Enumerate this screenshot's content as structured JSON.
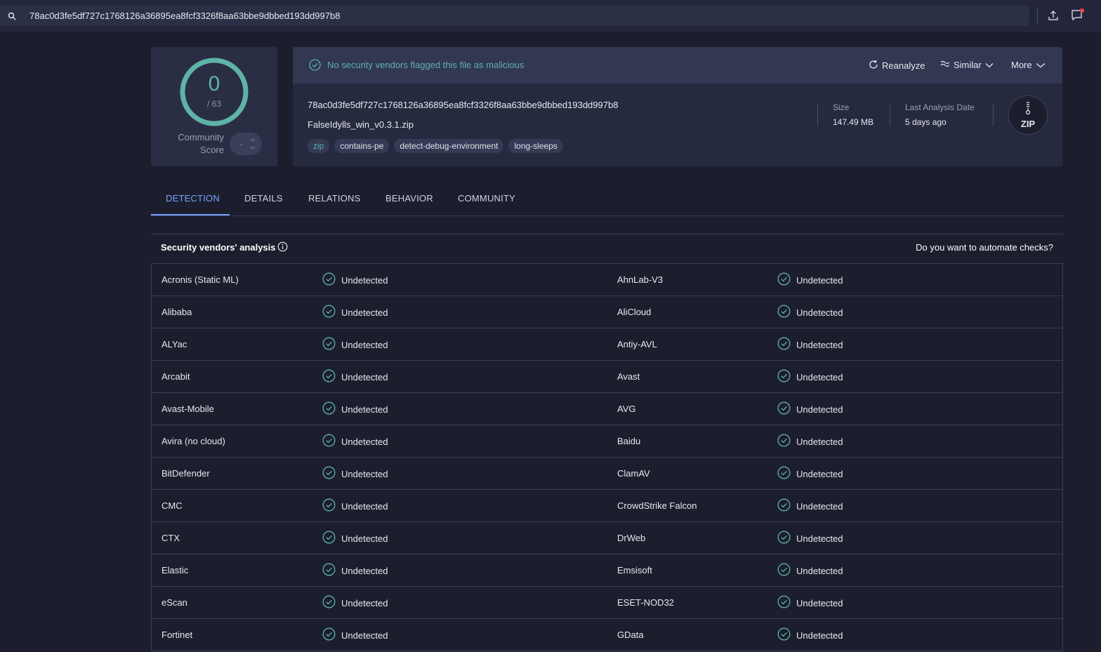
{
  "search": {
    "value": "78ac0d3fe5df727c1768126a36895ea8fcf3326f8aa63bbe9dbbed193dd997b8",
    "icon": "search-icon"
  },
  "top_icons": [
    "upload-icon",
    "chat-notification-icon"
  ],
  "score": {
    "detections": "0",
    "total": "/ 63",
    "community_label_1": "Community",
    "community_label_2": "Score",
    "ring_color": "#5fb3a6"
  },
  "header": {
    "banner_text": "No security vendors flagged this file as malicious",
    "actions": {
      "reanalyze": "Reanalyze",
      "similar": "Similar",
      "more": "More"
    },
    "file_hash": "78ac0d3fe5df727c1768126a36895ea8fcf3326f8aa63bbe9dbbed193dd997b8",
    "file_name": "FalseIdylls_win_v0.3.1.zip",
    "tags": [
      "zip",
      "contains-pe",
      "detect-debug-environment",
      "long-sleeps"
    ],
    "size_label": "Size",
    "size_value": "147.49 MB",
    "date_label": "Last Analysis Date",
    "date_value": "5 days ago",
    "file_type": "ZIP"
  },
  "tabs": [
    "DETECTION",
    "DETAILS",
    "RELATIONS",
    "BEHAVIOR",
    "COMMUNITY"
  ],
  "analysis": {
    "title": "Security vendors' analysis",
    "automate": "Do you want to automate checks?",
    "status_color": "#5fb3a6",
    "rows": [
      {
        "left": "Acronis (Static ML)",
        "left_status": "Undetected",
        "right": "AhnLab-V3",
        "right_status": "Undetected"
      },
      {
        "left": "Alibaba",
        "left_status": "Undetected",
        "right": "AliCloud",
        "right_status": "Undetected"
      },
      {
        "left": "ALYac",
        "left_status": "Undetected",
        "right": "Antiy-AVL",
        "right_status": "Undetected"
      },
      {
        "left": "Arcabit",
        "left_status": "Undetected",
        "right": "Avast",
        "right_status": "Undetected"
      },
      {
        "left": "Avast-Mobile",
        "left_status": "Undetected",
        "right": "AVG",
        "right_status": "Undetected"
      },
      {
        "left": "Avira (no cloud)",
        "left_status": "Undetected",
        "right": "Baidu",
        "right_status": "Undetected"
      },
      {
        "left": "BitDefender",
        "left_status": "Undetected",
        "right": "ClamAV",
        "right_status": "Undetected"
      },
      {
        "left": "CMC",
        "left_status": "Undetected",
        "right": "CrowdStrike Falcon",
        "right_status": "Undetected"
      },
      {
        "left": "CTX",
        "left_status": "Undetected",
        "right": "DrWeb",
        "right_status": "Undetected"
      },
      {
        "left": "Elastic",
        "left_status": "Undetected",
        "right": "Emsisoft",
        "right_status": "Undetected"
      },
      {
        "left": "eScan",
        "left_status": "Undetected",
        "right": "ESET-NOD32",
        "right_status": "Undetected"
      },
      {
        "left": "Fortinet",
        "left_status": "Undetected",
        "right": "GData",
        "right_status": "Undetected"
      }
    ]
  }
}
